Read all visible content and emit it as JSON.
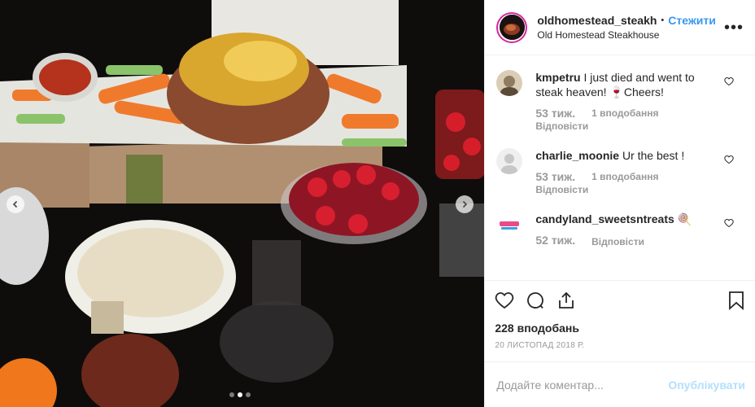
{
  "header": {
    "username": "oldhomestead_steakh",
    "separator": "•",
    "follow_label": "Стежити",
    "location": "Old Homestead Steakhouse",
    "more_label": "•••"
  },
  "comments": [
    {
      "username": "kmpetru",
      "text": "I just died and went to steak heaven! 🍷Cheers!",
      "time": "53 тиж.",
      "likes": "1 вподобання",
      "reply": "Відповісти"
    },
    {
      "username": "charlie_moonie",
      "text": "Ur the best !",
      "time": "53 тиж.",
      "likes": "1 вподобання",
      "reply": "Відповісти"
    },
    {
      "username": "candyland_sweetsntreats",
      "text": "🍭",
      "time": "52 тиж.",
      "likes": "",
      "reply": "Відповісти"
    }
  ],
  "post": {
    "like_count": "228 вподобань",
    "date": "20 ЛИСТОПАД 2018 Р."
  },
  "add_comment": {
    "placeholder": "Додайте коментар...",
    "publish_label": "Опублікувати"
  },
  "colors": {
    "accent": "#3897f0",
    "publish_disabled": "#b2dffc",
    "muted": "#999999"
  },
  "icons": [
    "chevron-left-icon",
    "chevron-right-icon",
    "heart-icon",
    "comment-icon",
    "share-icon",
    "bookmark-icon",
    "more-icon"
  ],
  "carousel": {
    "total": 3,
    "active": 2
  }
}
